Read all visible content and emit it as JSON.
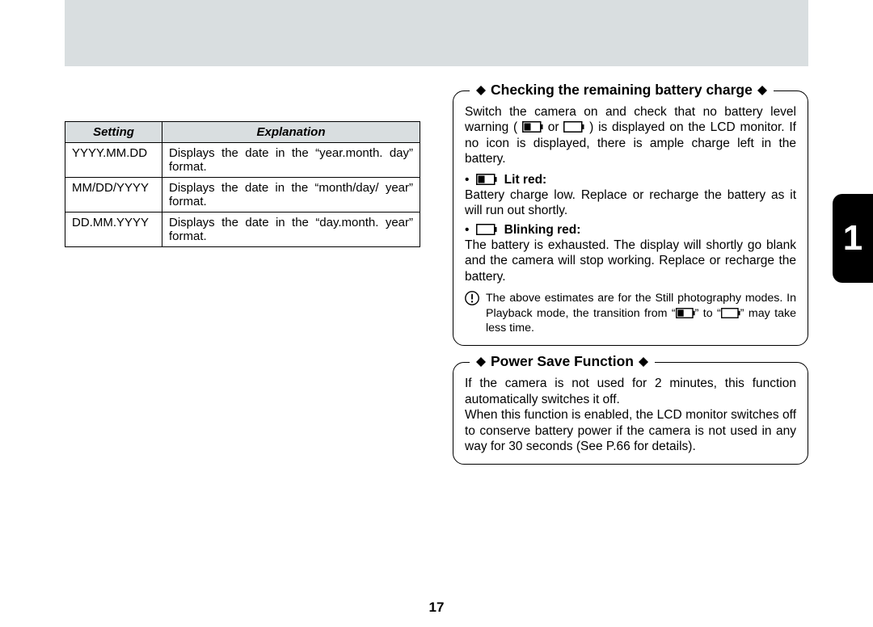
{
  "side_tab": {
    "number": "1"
  },
  "table": {
    "headers": {
      "setting": "Setting",
      "explanation": "Explanation"
    },
    "rows": [
      {
        "setting": "YYYY.MM.DD",
        "explanation": "Displays the date in the “year.month. day” format."
      },
      {
        "setting": "MM/DD/YYYY",
        "explanation": "Displays the date in the “month/day/ year” format."
      },
      {
        "setting": "DD.MM.YYYY",
        "explanation": "Displays the date in the “day.month. year” format."
      }
    ]
  },
  "box_battery": {
    "title": "Checking the remaining battery charge",
    "intro_before_icons": "Switch the camera on and check that no battery level warning (",
    "intro_mid": " or ",
    "intro_after_icons": ") is displayed on the LCD monitor. If no icon is displayed, there is ample charge left in the battery.",
    "item1_label": "Lit red:",
    "item1_text": "Battery charge low. Replace or recharge the battery as it will run out shortly.",
    "item2_label": "Blinking red:",
    "item2_text": "The battery is exhausted. The display will shortly go blank and the camera will stop working. Replace or recharge the battery.",
    "note_before": "The above estimates are for the Still photography modes. In Playback mode, the transition from “",
    "note_mid": "” to “",
    "note_after": "” may take less time."
  },
  "box_power": {
    "title": "Power Save Function",
    "para1": "If the camera is not used for 2 minutes, this function automatically switches it off.",
    "para2": "When this function is enabled, the LCD monitor switches off to conserve battery power if the camera is not used in any way for 30 seconds (See P.66 for details)."
  },
  "page_number": "17",
  "icons": {
    "battery_full_name": "battery-full-icon",
    "battery_low_name": "battery-low-icon",
    "battery_empty_name": "battery-empty-icon",
    "caution_name": "caution-icon",
    "diamond_name": "diamond-icon"
  }
}
